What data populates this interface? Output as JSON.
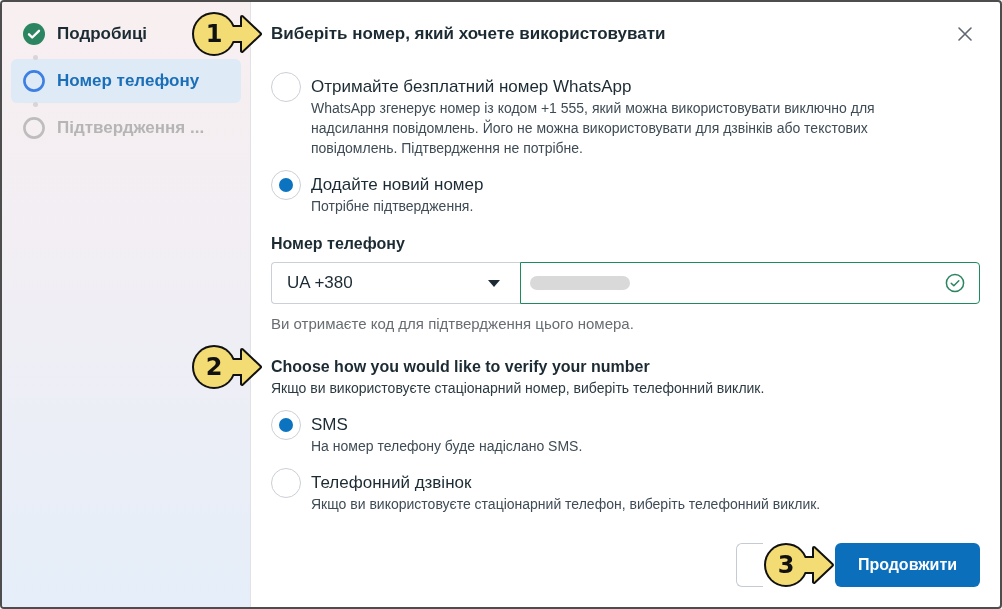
{
  "sidebar": {
    "steps": [
      {
        "label": "Подробиці",
        "completed": true,
        "selected": false
      },
      {
        "label": "Номер телефону",
        "completed": false,
        "selected": true
      },
      {
        "label": "Підтвердження ...",
        "completed": false,
        "selected": false
      }
    ]
  },
  "dialog": {
    "title": {
      "text": "Виберіть номер, який хочете використовувати",
      "callout": "1"
    },
    "number_options": [
      {
        "label": "Отримайте безплатний номер WhatsApp",
        "description": "WhatsApp згенерує номер із кодом +1 555, який можна використовувати виключно для надсилання повідомлень. Його не можна використовувати для дзвінків або текстових повідомлень. Підтвердження не потрібне.",
        "selected": false
      },
      {
        "label": "Додайте новий номер",
        "description": "Потрібне підтвердження.",
        "selected": true
      }
    ],
    "phone": {
      "label": "Номер телефону",
      "country_code": "UA +380",
      "redacted": true,
      "valid": true,
      "hint": "Ви отримаєте код для підтвердження цього номера."
    },
    "verification": {
      "heading": "Choose how you would like to verify your number",
      "callout": "2",
      "subtitle": "Якщо ви використовуєте стаціонарний номер, виберіть телефонний виклик.",
      "methods": [
        {
          "label": "SMS",
          "description": "На номер телефону буде надіслано SMS.",
          "selected": true
        },
        {
          "label": "Телефонний дзвінок",
          "description": "Якщо ви використовуєте стаціонарний телефон, виберіть телефонний виклик.",
          "selected": false
        }
      ]
    },
    "buttons": [
      {
        "kind": "secondary"
      },
      {
        "kind": "primary",
        "label": "Продовжити",
        "callout": "3"
      }
    ]
  }
}
